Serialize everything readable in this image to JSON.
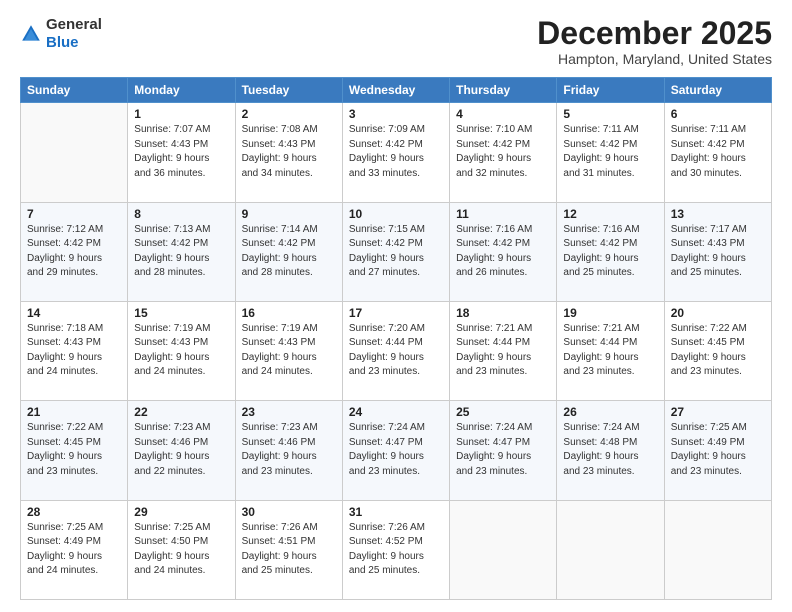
{
  "header": {
    "logo_general": "General",
    "logo_blue": "Blue",
    "month": "December 2025",
    "location": "Hampton, Maryland, United States"
  },
  "days_of_week": [
    "Sunday",
    "Monday",
    "Tuesday",
    "Wednesday",
    "Thursday",
    "Friday",
    "Saturday"
  ],
  "weeks": [
    [
      {
        "day": "",
        "info": ""
      },
      {
        "day": "1",
        "info": "Sunrise: 7:07 AM\nSunset: 4:43 PM\nDaylight: 9 hours\nand 36 minutes."
      },
      {
        "day": "2",
        "info": "Sunrise: 7:08 AM\nSunset: 4:43 PM\nDaylight: 9 hours\nand 34 minutes."
      },
      {
        "day": "3",
        "info": "Sunrise: 7:09 AM\nSunset: 4:42 PM\nDaylight: 9 hours\nand 33 minutes."
      },
      {
        "day": "4",
        "info": "Sunrise: 7:10 AM\nSunset: 4:42 PM\nDaylight: 9 hours\nand 32 minutes."
      },
      {
        "day": "5",
        "info": "Sunrise: 7:11 AM\nSunset: 4:42 PM\nDaylight: 9 hours\nand 31 minutes."
      },
      {
        "day": "6",
        "info": "Sunrise: 7:11 AM\nSunset: 4:42 PM\nDaylight: 9 hours\nand 30 minutes."
      }
    ],
    [
      {
        "day": "7",
        "info": "Sunrise: 7:12 AM\nSunset: 4:42 PM\nDaylight: 9 hours\nand 29 minutes."
      },
      {
        "day": "8",
        "info": "Sunrise: 7:13 AM\nSunset: 4:42 PM\nDaylight: 9 hours\nand 28 minutes."
      },
      {
        "day": "9",
        "info": "Sunrise: 7:14 AM\nSunset: 4:42 PM\nDaylight: 9 hours\nand 28 minutes."
      },
      {
        "day": "10",
        "info": "Sunrise: 7:15 AM\nSunset: 4:42 PM\nDaylight: 9 hours\nand 27 minutes."
      },
      {
        "day": "11",
        "info": "Sunrise: 7:16 AM\nSunset: 4:42 PM\nDaylight: 9 hours\nand 26 minutes."
      },
      {
        "day": "12",
        "info": "Sunrise: 7:16 AM\nSunset: 4:42 PM\nDaylight: 9 hours\nand 25 minutes."
      },
      {
        "day": "13",
        "info": "Sunrise: 7:17 AM\nSunset: 4:43 PM\nDaylight: 9 hours\nand 25 minutes."
      }
    ],
    [
      {
        "day": "14",
        "info": "Sunrise: 7:18 AM\nSunset: 4:43 PM\nDaylight: 9 hours\nand 24 minutes."
      },
      {
        "day": "15",
        "info": "Sunrise: 7:19 AM\nSunset: 4:43 PM\nDaylight: 9 hours\nand 24 minutes."
      },
      {
        "day": "16",
        "info": "Sunrise: 7:19 AM\nSunset: 4:43 PM\nDaylight: 9 hours\nand 24 minutes."
      },
      {
        "day": "17",
        "info": "Sunrise: 7:20 AM\nSunset: 4:44 PM\nDaylight: 9 hours\nand 23 minutes."
      },
      {
        "day": "18",
        "info": "Sunrise: 7:21 AM\nSunset: 4:44 PM\nDaylight: 9 hours\nand 23 minutes."
      },
      {
        "day": "19",
        "info": "Sunrise: 7:21 AM\nSunset: 4:44 PM\nDaylight: 9 hours\nand 23 minutes."
      },
      {
        "day": "20",
        "info": "Sunrise: 7:22 AM\nSunset: 4:45 PM\nDaylight: 9 hours\nand 23 minutes."
      }
    ],
    [
      {
        "day": "21",
        "info": "Sunrise: 7:22 AM\nSunset: 4:45 PM\nDaylight: 9 hours\nand 23 minutes."
      },
      {
        "day": "22",
        "info": "Sunrise: 7:23 AM\nSunset: 4:46 PM\nDaylight: 9 hours\nand 22 minutes."
      },
      {
        "day": "23",
        "info": "Sunrise: 7:23 AM\nSunset: 4:46 PM\nDaylight: 9 hours\nand 23 minutes."
      },
      {
        "day": "24",
        "info": "Sunrise: 7:24 AM\nSunset: 4:47 PM\nDaylight: 9 hours\nand 23 minutes."
      },
      {
        "day": "25",
        "info": "Sunrise: 7:24 AM\nSunset: 4:47 PM\nDaylight: 9 hours\nand 23 minutes."
      },
      {
        "day": "26",
        "info": "Sunrise: 7:24 AM\nSunset: 4:48 PM\nDaylight: 9 hours\nand 23 minutes."
      },
      {
        "day": "27",
        "info": "Sunrise: 7:25 AM\nSunset: 4:49 PM\nDaylight: 9 hours\nand 23 minutes."
      }
    ],
    [
      {
        "day": "28",
        "info": "Sunrise: 7:25 AM\nSunset: 4:49 PM\nDaylight: 9 hours\nand 24 minutes."
      },
      {
        "day": "29",
        "info": "Sunrise: 7:25 AM\nSunset: 4:50 PM\nDaylight: 9 hours\nand 24 minutes."
      },
      {
        "day": "30",
        "info": "Sunrise: 7:26 AM\nSunset: 4:51 PM\nDaylight: 9 hours\nand 25 minutes."
      },
      {
        "day": "31",
        "info": "Sunrise: 7:26 AM\nSunset: 4:52 PM\nDaylight: 9 hours\nand 25 minutes."
      },
      {
        "day": "",
        "info": ""
      },
      {
        "day": "",
        "info": ""
      },
      {
        "day": "",
        "info": ""
      }
    ]
  ]
}
